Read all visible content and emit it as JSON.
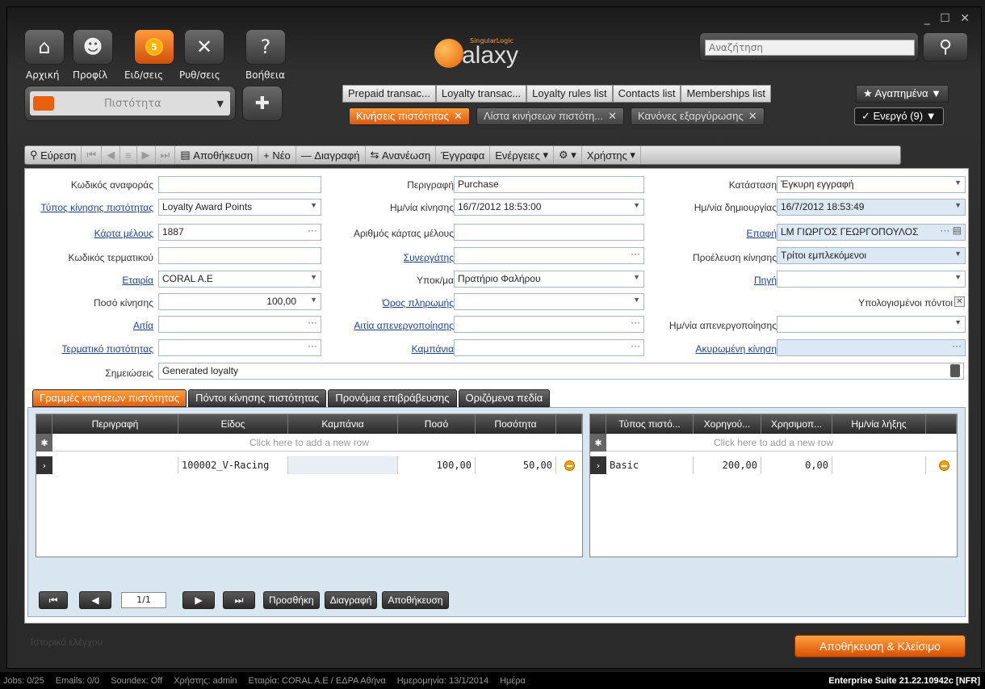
{
  "window": {
    "controls": "_ ☐ ✕"
  },
  "nav": [
    {
      "label": "Αρχική",
      "icon": "home-icon"
    },
    {
      "label": "Προφίλ",
      "icon": "profile-icon"
    },
    {
      "label": "Ειδ/σεις",
      "badge": "5"
    },
    {
      "label": "Ρυθ/σεις",
      "icon": "tools-icon"
    },
    {
      "label": "Βοήθεια",
      "icon": "help-icon"
    }
  ],
  "module": {
    "selected": "Πιστότητα"
  },
  "logo": {
    "brand": "SingularLogic",
    "name": "alaxy"
  },
  "search": {
    "placeholder": "Αναζήτηση"
  },
  "open_tabs": [
    "Prepaid transac...",
    "Loyalty transac...",
    "Loyalty rules list",
    "Contacts list",
    "Memberships list"
  ],
  "favorites": "★ Αγαπημένα ▼",
  "doc_tabs": [
    {
      "label": "Κινήσεις πιστότητας"
    },
    {
      "label": "Λίστα κινήσεων πιστότη..."
    },
    {
      "label": "Κανόνες εξαργύρωσης"
    }
  ],
  "active_count": "✓ Ενεργό (9) ▼",
  "toolbar": {
    "find": "Εύρεση",
    "save": "Αποθήκευση",
    "new": "Νέο",
    "delete": "Διαγραφή",
    "refresh": "Ανανέωση",
    "documents": "Έγγραφα",
    "actions": "Ενέργειες",
    "user": "Χρήστης"
  },
  "form": {
    "ref_code_label": "Κωδικός αναφοράς",
    "ref_code": "",
    "desc_label": "Περιγραφή",
    "desc": "Purchase",
    "status_label": "Κατάσταση",
    "status": "Έγκυρη εγγραφή",
    "type_label": "Τύπος κίνησης πιστότητας",
    "type": "Loyalty Award Points",
    "date_label": "Ημ/νία κίνησης",
    "date": "16/7/2012 18:53:00",
    "created_label": "Ημ/νία δημιουργίας",
    "created": "16/7/2012 18:53:49",
    "card_label": "Κάρτα μέλους",
    "card": "1887",
    "cardno_label": "Αριθμός κάρτας μέλους",
    "cardno": "",
    "contact_label": "Επαφή",
    "contact": "LM ΓΙΩΡΓΟΣ ΓΕΩΡΓΟΠΟΥΛΟΣ",
    "terminal_label": "Κωδικός τερματικού",
    "terminal": "",
    "partner_label": "Συνεργάτης",
    "partner": "",
    "origin_label": "Προέλευση κίνησης",
    "origin": "Τρίτοι εμπλεκόμενοι",
    "company_label": "Εταιρία",
    "company": "CORAL A.E",
    "branch_label": "Υποκ/μα",
    "branch": "Πρατήριο Φαλήρου",
    "source_label": "Πηγή",
    "source": "",
    "amount_label": "Ποσό κίνησης",
    "amount": "100,00",
    "payterm_label": "Όρος πληρωμής",
    "payterm": "",
    "calc_label": "Υπολογισμένοι πόντοι",
    "reason_label": "Αιτία",
    "reason": "",
    "deact_reason_label": "Αιτία απενεργοποίησης",
    "deact_reason": "",
    "deact_date_label": "Ημ/νία απενεργοποίησης",
    "deact_date": "",
    "loyterm_label": "Τερματικό πιστότητας",
    "loyterm": "",
    "campaign_label": "Καμπάνια",
    "campaign": "",
    "cancelled_label": "Ακυρωμένη κίνηση",
    "cancelled": "",
    "notes_label": "Σημειώσεις",
    "notes": "Generated loyalty"
  },
  "tabs": [
    "Γραμμές κινήσεων πιστότητας",
    "Πόντοι κίνησης πιστότητας",
    "Προνόμια επιβράβευσης",
    "Οριζόμενα πεδία"
  ],
  "grid1": {
    "headers": [
      "Περιγραφή",
      "Είδος",
      "Καμπάνια",
      "Ποσό",
      "Ποσότητα"
    ],
    "add": "Click here to add a new row",
    "row": {
      "desc": "",
      "item": "100002_V-Racing",
      "campaign": "",
      "amount": "100,00",
      "qty": "50,00"
    }
  },
  "grid2": {
    "headers": [
      "Τύπος πιστό...",
      "Χορηγού...",
      "Χρησιμοπ...",
      "Ημ/νία λήξης"
    ],
    "add": "Click here to add a new row",
    "row": {
      "type": "Basic",
      "granted": "200,00",
      "used": "0,00",
      "expires": ""
    }
  },
  "pager": {
    "page": "1/1",
    "add": "Προσθήκη",
    "delete": "Διαγραφή",
    "save": "Αποθήκευση"
  },
  "audit": "Ιστορικό ελέγχου",
  "save_close": "Αποθήκευση & Κλείσιμο",
  "statusbar": {
    "jobs": "Jobs: 0/25",
    "emails": "Emails: 0/0",
    "soundex": "Soundex: Off",
    "user": "Χρήστης: admin",
    "company": "Εταιρία: CORAL A.E / ΕΔΡΑ Αθήνα",
    "date": "Ημερομηνία: 13/1/2014",
    "day": "Ημέρα",
    "version": "Enterprise Suite 21.22.10942c [NFR]"
  },
  "colors": {
    "accent": "#e8701a",
    "dark": "#2a2a2a",
    "field_ro": "#dce8f4"
  }
}
